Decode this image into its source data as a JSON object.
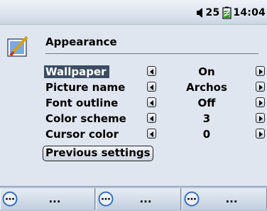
{
  "status": {
    "volume": "25",
    "time": "14:04"
  },
  "header": {
    "title": "Appearance"
  },
  "settings": [
    {
      "label": "Wallpaper",
      "value": "On",
      "selected": true
    },
    {
      "label": "Picture name",
      "value": "Archos",
      "selected": false
    },
    {
      "label": "Font outline",
      "value": "Off",
      "selected": false
    },
    {
      "label": "Color scheme",
      "value": "3",
      "selected": false
    },
    {
      "label": "Cursor color",
      "value": "0",
      "selected": false
    }
  ],
  "previous_button": "Previous settings",
  "softkeys": [
    {
      "label": "..."
    },
    {
      "label": "..."
    },
    {
      "label": "..."
    }
  ],
  "colors": {
    "background": "#dfe6f0",
    "selection": "#3c4c62",
    "softkey_bar": "#b9c6d9"
  },
  "icons": [
    "speaker-icon",
    "battery-icon",
    "appearance-brush-icon",
    "softkey-circle-icon"
  ]
}
